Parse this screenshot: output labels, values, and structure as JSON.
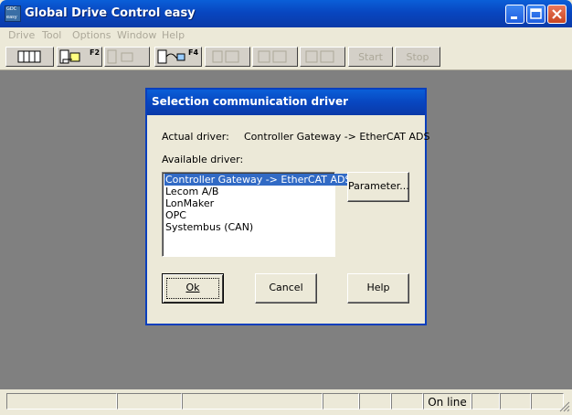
{
  "window": {
    "title": "Global Drive Control easy",
    "icon_text": [
      "GDC",
      "easy"
    ]
  },
  "menu": [
    "Drive",
    "Tool",
    "Options",
    "Window",
    "Help"
  ],
  "toolbar": {
    "f2_key": "F2",
    "f4_key": "F4",
    "start_label": "Start",
    "stop_label": "Stop"
  },
  "dialog": {
    "title": "Selection communication driver",
    "actual_driver_label": "Actual driver:",
    "actual_driver_value": "Controller Gateway -> EtherCAT ADS",
    "available_driver_label": "Available driver:",
    "drivers": [
      "Controller Gateway -> EtherCAT ADS",
      "Lecom A/B",
      "LonMaker",
      "OPC",
      "Systembus (CAN)"
    ],
    "selected_index": 0,
    "parameter_button": "Parameter...",
    "ok_button": "Ok",
    "cancel_button": "Cancel",
    "help_button": "Help"
  },
  "status": {
    "online_text": "On line"
  },
  "colors": {
    "title_blue": "#0a4fd0",
    "client_gray": "#808080",
    "selection": "#316ac5"
  }
}
